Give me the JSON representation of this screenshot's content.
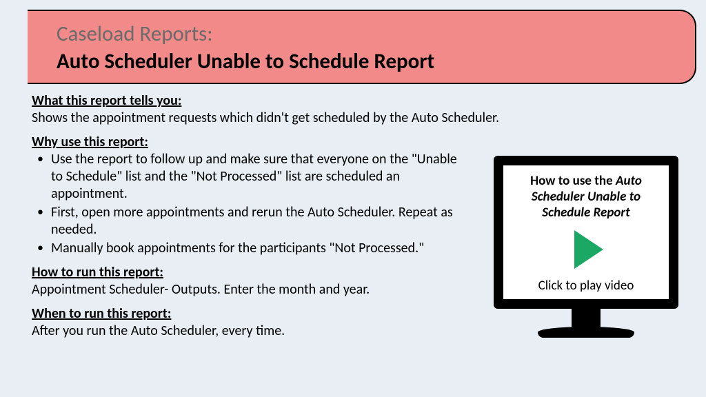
{
  "header": {
    "thin": "Caseload Reports:",
    "bold": "Auto Scheduler Unable to Schedule Report"
  },
  "sections": {
    "what_heading": "What this report tells you:",
    "what_text": "Shows the appointment requests which didn't get scheduled by the Auto Scheduler.",
    "why_heading": "Why use this report:",
    "why_b1": "Use the report to follow up and make sure that everyone on the \"Unable to Schedule\" list and the \"Not Processed\" list are scheduled an appointment.",
    "why_b2": "First, open more appointments and rerun the Auto Scheduler. Repeat as needed.",
    "why_b3": "Manually book appointments for the participants \"Not Processed.\"",
    "how_heading": "How to run this report:",
    "how_text": "Appointment Scheduler- Outputs. Enter the month and year.",
    "when_heading": "When to run this report:",
    "when_text": "After you run the Auto Scheduler, every time."
  },
  "video": {
    "title_prefix": "How to use the ",
    "title_italic": "Auto Scheduler Unable to Schedule Report",
    "caption": "Click to play video"
  }
}
